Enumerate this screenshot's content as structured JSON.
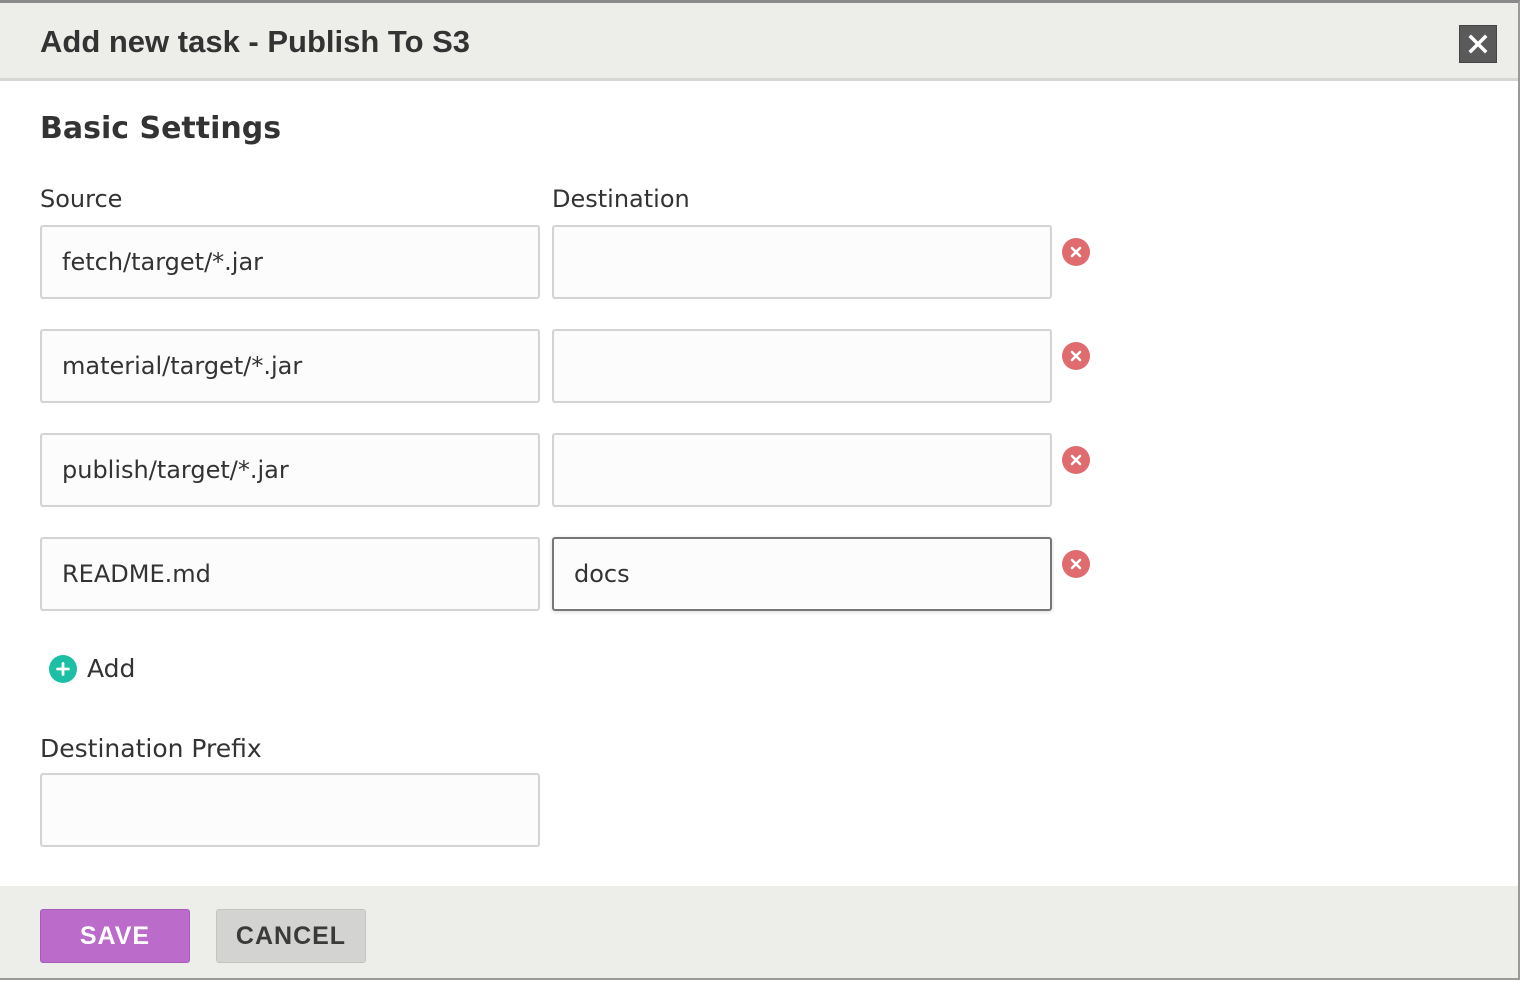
{
  "dialog": {
    "title": "Add new task - Publish To S3",
    "close_icon": "close-x-icon"
  },
  "basic_settings": {
    "heading": "Basic Settings",
    "source_label": "Source",
    "destination_label": "Destination",
    "rows": [
      {
        "source": "fetch/target/*.jar",
        "destination": "",
        "remove_icon": "remove-circle-icon"
      },
      {
        "source": "material/target/*.jar",
        "destination": "",
        "remove_icon": "remove-circle-icon"
      },
      {
        "source": "publish/target/*.jar",
        "destination": "",
        "remove_icon": "remove-circle-icon"
      },
      {
        "source": "README.md",
        "destination": "docs",
        "remove_icon": "remove-circle-icon",
        "focused": true
      }
    ],
    "add_label": "Add",
    "add_icon": "plus-circle-icon",
    "prefix_label": "Destination Prefix",
    "prefix_value": ""
  },
  "footer": {
    "save_label": "SAVE",
    "cancel_label": "CANCEL"
  },
  "colors": {
    "header_bg": "#ededea",
    "save_button": "#bb6bc9",
    "cancel_button": "#d3d3d1",
    "remove_icon": "#e06b6e",
    "add_icon": "#1dbfa4"
  }
}
